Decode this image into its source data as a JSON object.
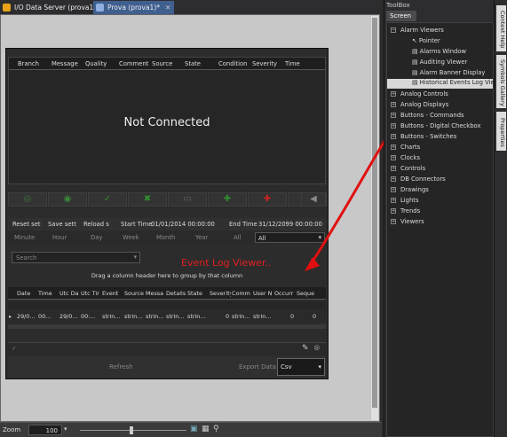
{
  "tabs": [
    {
      "label": "I/O Data Server (prova1)",
      "close": "✕"
    },
    {
      "label": "Prova (prova1)*",
      "close": "✕"
    }
  ],
  "grid1": {
    "columns": [
      "Branch",
      "Message",
      "Quality",
      "Comment",
      "Source",
      "State",
      "Condition",
      "Severity",
      "Time"
    ],
    "status": "Not Connected"
  },
  "filter": {
    "reset": "Reset set",
    "save": "Save sett",
    "reload": "Reload s",
    "start_label": "Start Time",
    "start_value": "01/01/2014 00:00:00",
    "end_label": "End Time",
    "end_value": "31/12/2099 00:00:00",
    "periods": [
      "Minute",
      "Hour",
      "Day",
      "Week",
      "Month",
      "Year",
      "All"
    ],
    "period_select": "All"
  },
  "search_placeholder": "Search",
  "drag_hint": "Drag a column header here to group by that column",
  "annotation": "Event Log Viewer..",
  "grid2": {
    "columns": [
      "Date",
      "Time",
      "Utc Da",
      "Utc Tir",
      "Event",
      "Source",
      "Messa",
      "Details",
      "State",
      "Severity",
      "Comm",
      "User N",
      "Occurr",
      "Seque"
    ],
    "row": [
      "29/0...",
      "00...",
      "29/0...",
      "00:...",
      "strin...",
      "strin...",
      "strin...",
      "strin...",
      "strin...",
      "0",
      "strin...",
      "strin...",
      "0",
      "0"
    ]
  },
  "footer": {
    "refresh": "Refresh",
    "export_label": "Export Data",
    "export_value": "Csv"
  },
  "zoom": {
    "label": "Zoom",
    "value": "100"
  },
  "toolbox": {
    "title": "ToolBox",
    "tab": "Screen",
    "alarm_group": "Alarm Viewers",
    "alarm_items": [
      "Pointer",
      "Alarms Window",
      "Auditing Viewer",
      "Alarm Banner Display",
      "Historical Events Log Viewer"
    ],
    "groups": [
      "Analog Controls",
      "Analog Displays",
      "Buttons - Commands",
      "Buttons - Digital Checkbox",
      "Buttons - Switches",
      "Charts",
      "Clocks",
      "Controls",
      "DB Connectors",
      "Drawings",
      "Lights",
      "Trends",
      "Viewers"
    ]
  },
  "side_tabs": [
    "Context Help",
    "Symbols Gallery",
    "Properties"
  ]
}
